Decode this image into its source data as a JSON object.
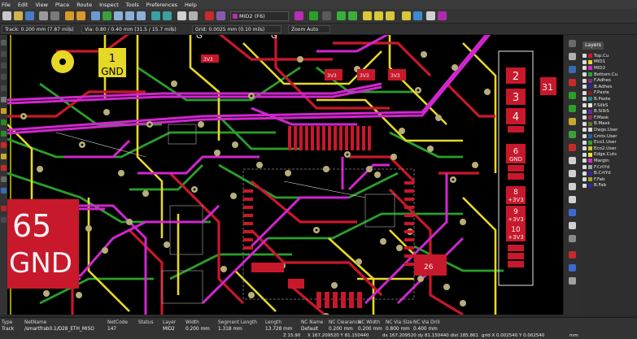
{
  "menu": [
    "File",
    "Edit",
    "View",
    "Place",
    "Route",
    "Inspect",
    "Tools",
    "Preferences",
    "Help"
  ],
  "toolbar": {
    "active_layer": "MID2 (F6)",
    "active_layer_color": "#b92eb4"
  },
  "options": {
    "track": "Track: 0.200 mm (7.87 mils)",
    "via": "Via: 0.80 / 0.40 mm (31.5 / 15.7 mils)",
    "grid": "Grid: 0.0025 mm (0.10 mils)",
    "zoom": "Zoom Auto"
  },
  "board": {
    "pad_labels": [
      "1",
      "GND"
    ],
    "big_labels": [
      "65",
      "GND"
    ],
    "vias_3v3": [
      "3V3",
      "3V3",
      "3V3",
      "3V3"
    ],
    "misc_labels": [
      "G",
      "G",
      "26"
    ],
    "connector": [
      {
        "num": "2",
        "net": ""
      },
      {
        "num": "3",
        "net": ""
      },
      {
        "num": "4",
        "net": ""
      },
      {
        "num": "6",
        "net": "GND"
      },
      {
        "num": "8",
        "net": "+3V3"
      },
      {
        "num": "9",
        "net": "+3V3"
      },
      {
        "num": "10",
        "net": "+3V3"
      }
    ],
    "side_label": "31",
    "colors": {
      "front": "#c8182b",
      "back": "#2aa02a",
      "mid1": "#e6d826",
      "mid2": "#d126cf",
      "via": "#b9ae7a",
      "edge": "#ffff00"
    }
  },
  "layers": {
    "tab": "Layers",
    "items": [
      {
        "name": "Top.Cu",
        "color": "#c8182b"
      },
      {
        "name": "MID1",
        "color": "#e6d826"
      },
      {
        "name": "MID2",
        "color": "#d126cf"
      },
      {
        "name": "Bottom.Cu",
        "color": "#2aa02a"
      },
      {
        "name": "F.Adhes",
        "color": "#8a2a8a"
      },
      {
        "name": "B.Adhes",
        "color": "#2a2a8a"
      },
      {
        "name": "F.Paste",
        "color": "#8a1c1c"
      },
      {
        "name": "B.Paste",
        "color": "#1c8a8a"
      },
      {
        "name": "F.SilkS",
        "color": "#e8e8e8"
      },
      {
        "name": "B.SilkS",
        "color": "#6a2aa0"
      },
      {
        "name": "F.Mask",
        "color": "#8a2a6a"
      },
      {
        "name": "B.Mask",
        "color": "#6a6a2a"
      },
      {
        "name": "Dwgs.User",
        "color": "#d8d8d8"
      },
      {
        "name": "Cmts.User",
        "color": "#2a5aa0"
      },
      {
        "name": "Eco1.User",
        "color": "#2aa02a"
      },
      {
        "name": "Eco2.User",
        "color": "#c8c82a"
      },
      {
        "name": "Edge.Cuts",
        "color": "#e8e82a"
      },
      {
        "name": "Margin",
        "color": "#d02ad0"
      },
      {
        "name": "F.CrtYd",
        "color": "#a0a0a0"
      },
      {
        "name": "B.CrtYd",
        "color": "#2a2aa0"
      },
      {
        "name": "F.Fab",
        "color": "#a0a02a"
      },
      {
        "name": "B.Fab",
        "color": "#2a2aa0"
      }
    ]
  },
  "status": {
    "columns": [
      {
        "head": "Type",
        "val": "Track"
      },
      {
        "head": "NetName",
        "val": "/smartfrab0.1/D28_ETH_MISO"
      },
      {
        "head": "NetCode",
        "val": "147"
      },
      {
        "head": "Status",
        "val": ""
      },
      {
        "head": "Layer",
        "val": "MID2"
      },
      {
        "head": "Width",
        "val": "0.200 mm"
      },
      {
        "head": "Segment Length",
        "val": "1.318 mm"
      },
      {
        "head": "Length",
        "val": "13.728 mm"
      },
      {
        "head": "NC Name",
        "val": "Default"
      },
      {
        "head": "NC Clearance",
        "val": "0.200 mm"
      },
      {
        "head": "NC Width",
        "val": "0.200 mm"
      },
      {
        "head": "NC Via Size",
        "val": "0.800 mm"
      },
      {
        "head": "NC Via Drill",
        "val": "0.400 mm"
      }
    ],
    "z": "Z 15.90",
    "xy": "X 167.209520  Y 81.150440",
    "dxy": "dx 167.209520  dy 81.150440  dist 185.861",
    "grid": "grid X 0.002540  Y 0.002540",
    "units": "mm"
  }
}
